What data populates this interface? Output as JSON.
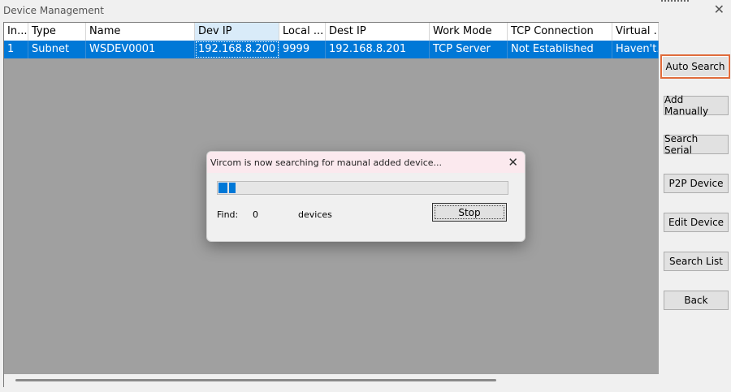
{
  "window": {
    "title": "Device Management"
  },
  "table": {
    "columns": [
      {
        "label": "In...",
        "w": 30
      },
      {
        "label": "Type",
        "w": 71
      },
      {
        "label": "Name",
        "w": 134
      },
      {
        "label": "Dev IP",
        "w": 104
      },
      {
        "label": "Local ...",
        "w": 57
      },
      {
        "label": "Dest IP",
        "w": 128
      },
      {
        "label": "Work Mode",
        "w": 96
      },
      {
        "label": "TCP Connection",
        "w": 129
      },
      {
        "label": "Virtual ...",
        "w": 57
      }
    ],
    "rows": [
      [
        "1",
        "Subnet",
        "WSDEV0001",
        "192.168.8.200",
        "9999",
        "192.168.8.201",
        "TCP Server",
        "Not Established",
        "Haven't..."
      ]
    ]
  },
  "sidebar": {
    "auto_search": "Auto Search",
    "add_manually": "Add Manually",
    "search_serial": "Search Serial",
    "p2p_device": "P2P Device",
    "edit_device": "Edit Device",
    "search_list": "Search List",
    "back": "Back"
  },
  "dialog": {
    "title": "Vircom is now searching for maunal added device...",
    "progress": 0.06,
    "find_label": "Find:",
    "find_count": "0",
    "find_unit": "devices",
    "stop_label": "Stop"
  },
  "icons": {
    "close": "close-icon"
  },
  "colors": {
    "selection": "#0078d7",
    "highlight_border": "#e06c3c"
  }
}
